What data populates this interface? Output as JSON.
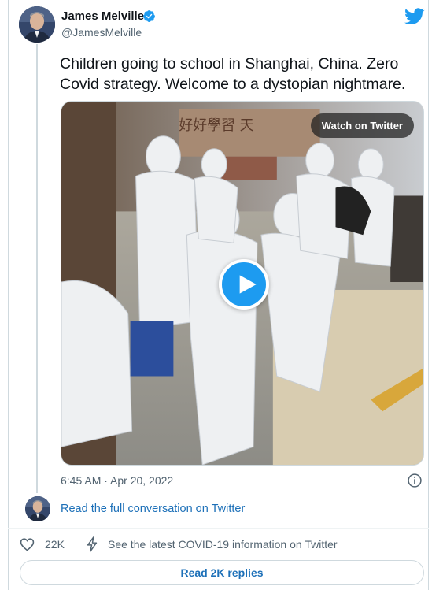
{
  "author": {
    "name": "James Melville",
    "handle": "@JamesMelville"
  },
  "tweet": {
    "text": "Children going to school in Shanghai, China. Zero Covid strategy. Welcome to a dystopian nightmare.",
    "timestamp": "6:45 AM · Apr 20, 2022"
  },
  "video": {
    "watch_label": "Watch on Twitter",
    "banner_text": "好好學習 天"
  },
  "conversation": {
    "read_label": "Read the full conversation on Twitter"
  },
  "actions": {
    "like_count": "22K",
    "covid_label": "See the latest COVID-19 information on Twitter"
  },
  "replies": {
    "label": "Read 2K replies"
  },
  "colors": {
    "brand_blue": "#1d9bf0",
    "link_blue": "#1d70b8",
    "text_secondary": "#536471",
    "border": "#cfd9de"
  },
  "icons": [
    "verified-icon",
    "twitter-bird-icon",
    "play-icon",
    "info-icon",
    "heart-icon",
    "lightning-bolt-icon"
  ]
}
